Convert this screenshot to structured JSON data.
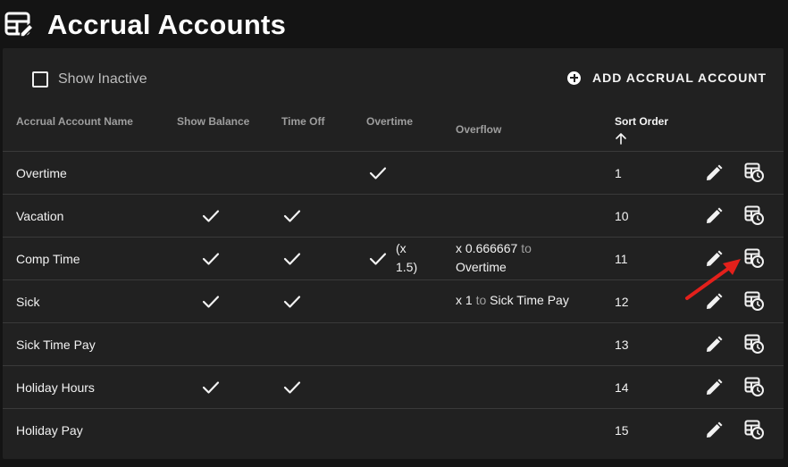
{
  "header": {
    "title": "Accrual Accounts",
    "icon": "table-edit-icon"
  },
  "toolbar": {
    "show_inactive_label": "Show Inactive",
    "show_inactive_checked": false,
    "add_button_label": "ADD ACCRUAL ACCOUNT"
  },
  "table": {
    "columns": {
      "name": "Accrual Account Name",
      "show_balance": "Show Balance",
      "time_off": "Time Off",
      "overtime": "Overtime",
      "overflow": "Overflow",
      "sort_order": "Sort Order"
    },
    "sort_column": "sort_order",
    "sort_direction": "ascending",
    "rows": [
      {
        "name": "Overtime",
        "show_balance": false,
        "time_off": false,
        "overtime": true,
        "overtime_extra": "",
        "overflow_prefix": "",
        "overflow_to": "",
        "overflow_target": "",
        "sort_order": "1"
      },
      {
        "name": "Vacation",
        "show_balance": true,
        "time_off": true,
        "overtime": false,
        "overtime_extra": "",
        "overflow_prefix": "",
        "overflow_to": "",
        "overflow_target": "",
        "sort_order": "10"
      },
      {
        "name": "Comp Time",
        "show_balance": true,
        "time_off": true,
        "overtime": true,
        "overtime_extra": "(x 1.5)",
        "overflow_prefix": "x 0.666667",
        "overflow_to": "to",
        "overflow_target": "Overtime",
        "sort_order": "11"
      },
      {
        "name": "Sick",
        "show_balance": true,
        "time_off": true,
        "overtime": false,
        "overtime_extra": "",
        "overflow_prefix": "x 1",
        "overflow_to": "to",
        "overflow_target": "Sick Time Pay",
        "sort_order": "12"
      },
      {
        "name": "Sick Time Pay",
        "show_balance": false,
        "time_off": false,
        "overtime": false,
        "overtime_extra": "",
        "overflow_prefix": "",
        "overflow_to": "",
        "overflow_target": "",
        "sort_order": "13"
      },
      {
        "name": "Holiday Hours",
        "show_balance": true,
        "time_off": true,
        "overtime": false,
        "overtime_extra": "",
        "overflow_prefix": "",
        "overflow_to": "",
        "overflow_target": "",
        "sort_order": "14"
      },
      {
        "name": "Holiday Pay",
        "show_balance": false,
        "time_off": false,
        "overtime": false,
        "overtime_extra": "",
        "overflow_prefix": "",
        "overflow_to": "",
        "overflow_target": "",
        "sort_order": "15"
      }
    ],
    "row_actions": [
      "pencil-icon",
      "table-clock-icon"
    ]
  },
  "annotation": {
    "type": "arrow",
    "color": "#e3201b",
    "points_to": "Vacation row schedule action"
  },
  "colors": {
    "background": "#141414",
    "card": "#212121",
    "divider": "#3a3a3a",
    "header_text": "#9e9e9e",
    "text": "#f2f2f2"
  }
}
